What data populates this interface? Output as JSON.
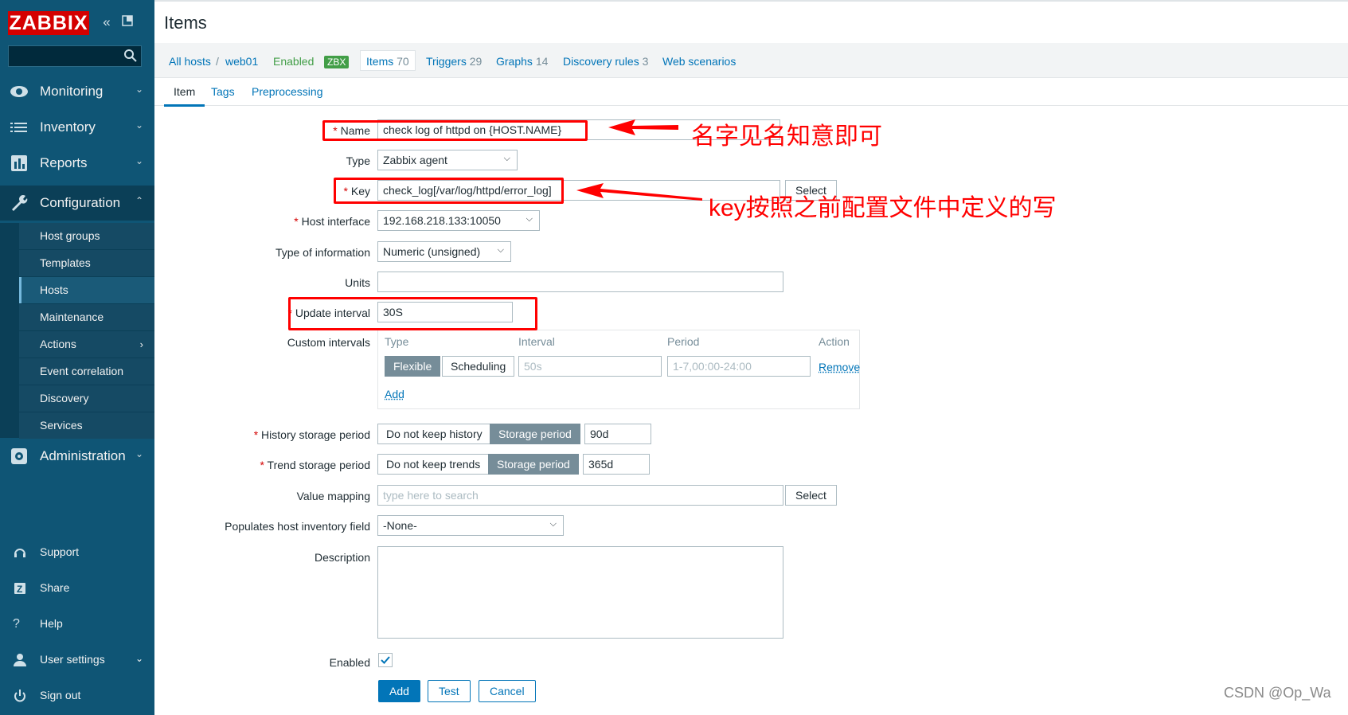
{
  "sidebar": {
    "logo": "ZABBIX",
    "collapse_icon": "double-chevron-left-icon",
    "kiosk_icon": "kiosk-mode-icon",
    "search_icon": "search-icon",
    "menu": [
      {
        "label": "Monitoring",
        "icon": "eye-icon"
      },
      {
        "label": "Inventory",
        "icon": "list-icon"
      },
      {
        "label": "Reports",
        "icon": "bar-chart-icon"
      },
      {
        "label": "Configuration",
        "icon": "wrench-icon"
      },
      {
        "label": "Administration",
        "icon": "gear-icon"
      }
    ],
    "submenu": [
      "Host groups",
      "Templates",
      "Hosts",
      "Maintenance",
      "Actions",
      "Event correlation",
      "Discovery",
      "Services"
    ],
    "bottom": [
      "Support",
      "Share",
      "Help",
      "User settings",
      "Sign out"
    ]
  },
  "header": {
    "title": "Items"
  },
  "breadcrumb": {
    "all_hosts": "All hosts",
    "sep": "/",
    "host": "web01",
    "status": "Enabled",
    "zbx": "ZBX",
    "items": "Items",
    "items_count": "70",
    "triggers": "Triggers",
    "triggers_count": "29",
    "graphs": "Graphs",
    "graphs_count": "14",
    "discovery": "Discovery rules",
    "discovery_count": "3",
    "web": "Web scenarios"
  },
  "tabs": [
    "Item",
    "Tags",
    "Preprocessing"
  ],
  "form": {
    "name_label": "Name",
    "name_value": "check log of httpd on {HOST.NAME}",
    "type_label": "Type",
    "type_value": "Zabbix agent",
    "key_label": "Key",
    "key_value": "check_log[/var/log/httpd/error_log]",
    "key_select": "Select",
    "iface_label": "Host interface",
    "iface_value": "192.168.218.133:10050",
    "toi_label": "Type of information",
    "toi_value": "Numeric (unsigned)",
    "units_label": "Units",
    "units_value": "",
    "interval_label": "Update interval",
    "interval_value": "30S",
    "custom_label": "Custom intervals",
    "ci_type": "Type",
    "ci_interval": "Interval",
    "ci_period": "Period",
    "ci_action": "Action",
    "ci_flexible": "Flexible",
    "ci_scheduling": "Scheduling",
    "ci_interval_ph": "50s",
    "ci_period_ph": "1-7,00:00-24:00",
    "ci_remove": "Remove",
    "ci_add": "Add",
    "history_label": "History storage period",
    "history_nokeep": "Do not keep history",
    "history_storage": "Storage period",
    "history_value": "90d",
    "trend_label": "Trend storage period",
    "trend_nokeep": "Do not keep trends",
    "trend_storage": "Storage period",
    "trend_value": "365d",
    "vm_label": "Value mapping",
    "vm_placeholder": "type here to search",
    "vm_select": "Select",
    "inv_label": "Populates host inventory field",
    "inv_value": "-None-",
    "desc_label": "Description",
    "desc_value": "",
    "enabled_label": "Enabled",
    "enabled": true,
    "req_mark": "*"
  },
  "actions": {
    "add": "Add",
    "test": "Test",
    "cancel": "Cancel"
  },
  "annotations": {
    "name_note": "名字见名知意即可",
    "key_note": "key按照之前配置文件中定义的写",
    "color": "#ff0000"
  },
  "watermark": "CSDN @Op_Wa"
}
